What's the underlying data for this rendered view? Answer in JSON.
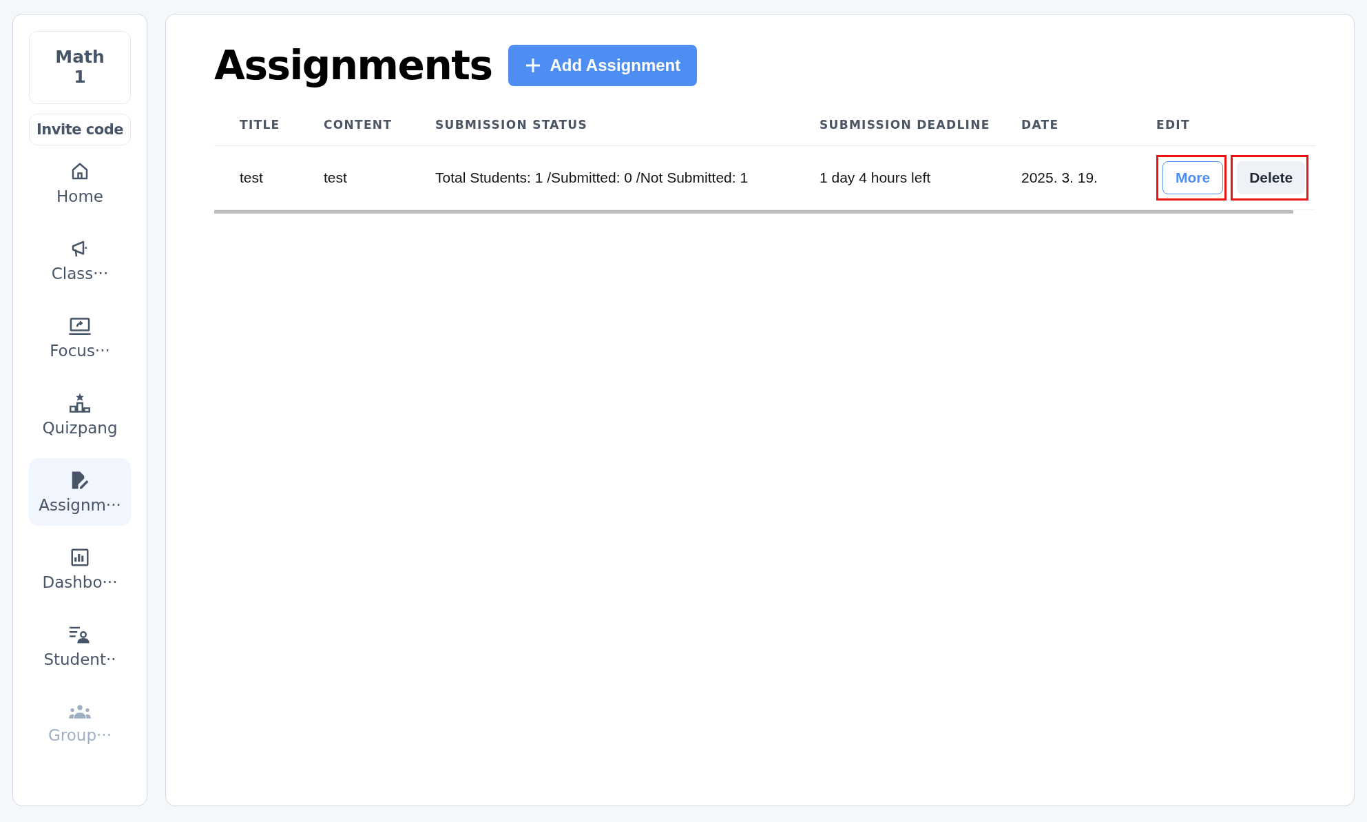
{
  "sidebar": {
    "class_name": "Math\n1",
    "invite_button": "Invite code",
    "items": [
      {
        "kind": "home",
        "label": "Home",
        "selected": false,
        "disabled": false
      },
      {
        "kind": "megaphone",
        "label": "Class···",
        "selected": false,
        "disabled": false
      },
      {
        "kind": "screen",
        "label": "Focus···",
        "selected": false,
        "disabled": false
      },
      {
        "kind": "podium",
        "label": "Quizpang",
        "selected": false,
        "disabled": false
      },
      {
        "kind": "edit",
        "label": "Assignm···",
        "selected": true,
        "disabled": false
      },
      {
        "kind": "chart",
        "label": "Dashbo···",
        "selected": false,
        "disabled": false
      },
      {
        "kind": "students",
        "label": "Student··",
        "selected": false,
        "disabled": false
      },
      {
        "kind": "group",
        "label": "Group···",
        "selected": false,
        "disabled": true
      }
    ]
  },
  "page": {
    "title": "Assignments",
    "add_button": "Add Assignment"
  },
  "table": {
    "columns": [
      "TITLE",
      "CONTENT",
      "SUBMISSION STATUS",
      "SUBMISSION DEADLINE",
      "DATE",
      "EDIT"
    ],
    "rows": [
      {
        "title": "test",
        "content": "test",
        "status": "Total Students: 1 /Submitted: 0 /Not Submitted: 1",
        "deadline": "1 day 4 hours left",
        "date": "2025. 3. 19.",
        "more_button": "More",
        "delete_button": "Delete"
      }
    ]
  }
}
